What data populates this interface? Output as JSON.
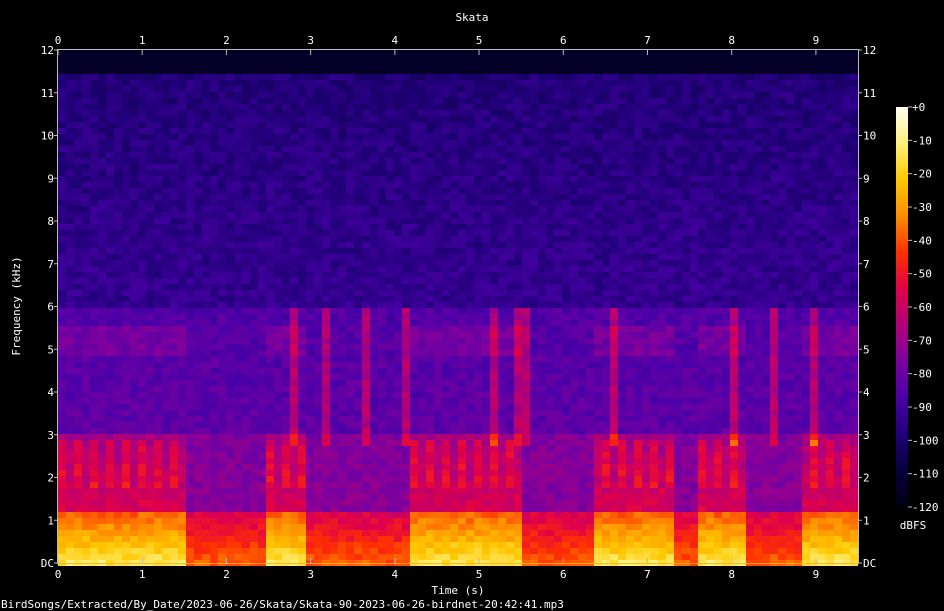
{
  "chart_data": {
    "type": "heatmap",
    "title": "Skata",
    "xlabel": "Time (s)",
    "ylabel": "Frequency (kHz)",
    "xlim": [
      0,
      9.5
    ],
    "ylim": [
      0,
      12
    ],
    "x_ticks": [
      "0",
      "1",
      "2",
      "3",
      "4",
      "5",
      "6",
      "7",
      "8",
      "9"
    ],
    "y_ticks": [
      "DC",
      "1",
      "2",
      "3",
      "4",
      "5",
      "6",
      "7",
      "8",
      "9",
      "10",
      "11",
      "12"
    ],
    "colorbar": {
      "label": "dBFS",
      "range": [
        -120,
        0
      ],
      "ticks": [
        "+0",
        "-10",
        "-20",
        "-30",
        "-40",
        "-50",
        "-60",
        "-70",
        "-80",
        "-90",
        "-100",
        "-110",
        "-120"
      ],
      "colors": [
        "#fffff0",
        "#fff07a",
        "#ffc800",
        "#ff8c00",
        "#ff3000",
        "#e0004a",
        "#b0007a",
        "#7a00a0",
        "#4a00a8",
        "#200078",
        "#08003c",
        "#000010"
      ]
    },
    "filename": "BirdSongs/Extracted/By_Date/2023-06-26/Skata/Skata-90-2023-06-26-birdnet-20:42:41.mp3",
    "noise_floor_khz": 11.5,
    "energy_segments_s": [
      [
        0,
        1.55
      ],
      [
        2.45,
        2.9
      ],
      [
        4.15,
        5.5
      ],
      [
        6.4,
        7.35
      ],
      [
        7.6,
        8.2
      ],
      [
        8.8,
        9.5
      ]
    ],
    "call_streaks_s": [
      2.8,
      3.2,
      3.65,
      4.1,
      5.2,
      5.5,
      6.6,
      8.05,
      8.5,
      8.95
    ]
  }
}
